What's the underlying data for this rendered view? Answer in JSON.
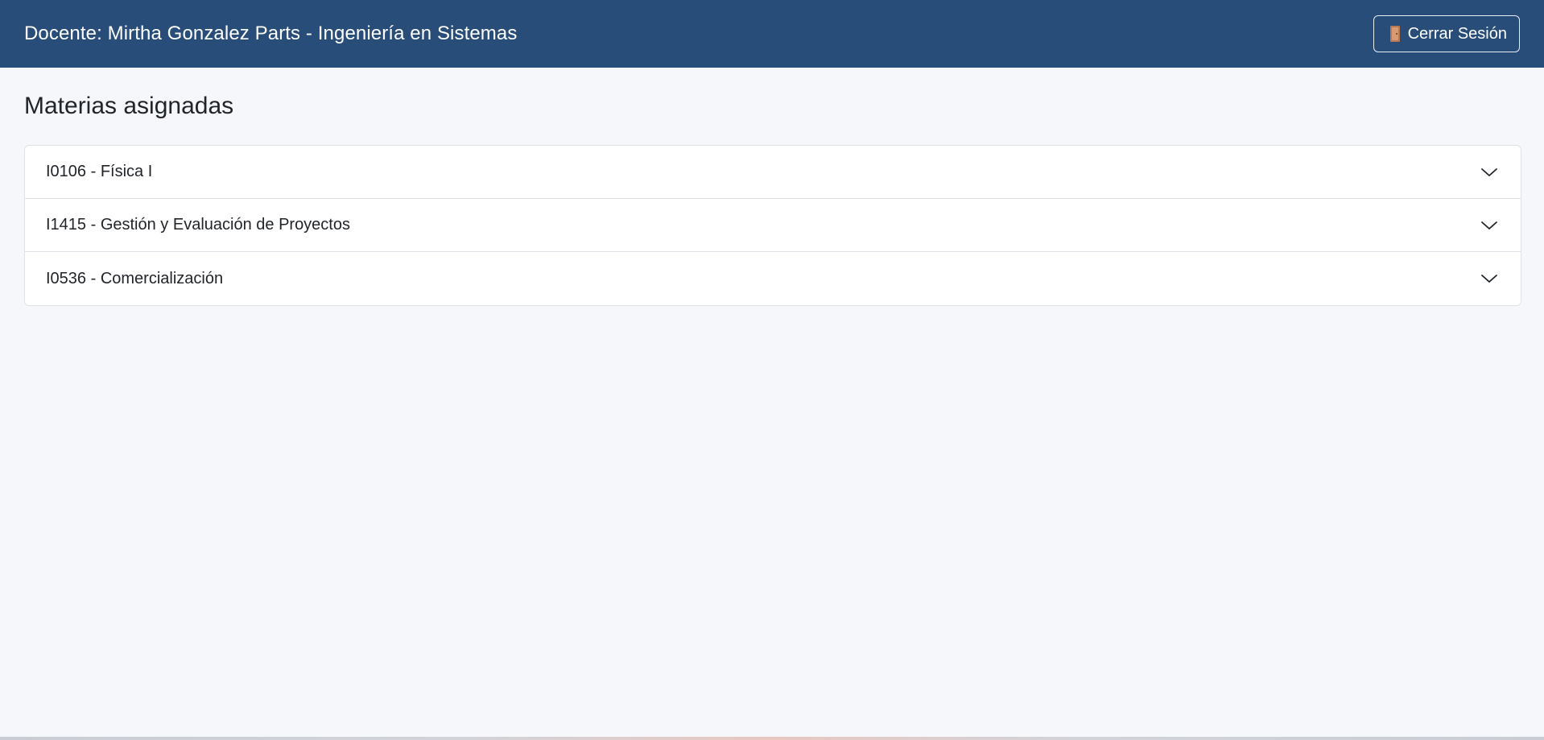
{
  "header": {
    "title": "Docente: Mirtha Gonzalez Parts - Ingeniería en Sistemas",
    "logout_label": "Cerrar Sesión",
    "logout_icon": "door-icon"
  },
  "main": {
    "title": "Materias asignadas",
    "subjects": [
      {
        "label": "I0106 - Física I",
        "icon": "chevron-down-icon"
      },
      {
        "label": "I1415 - Gestión y Evaluación de Proyectos",
        "icon": "chevron-down-icon"
      },
      {
        "label": "I0536 - Comercialización",
        "icon": "chevron-down-icon"
      }
    ]
  },
  "colors": {
    "header_bg": "#284d79",
    "page_bg": "#f5f7fb",
    "card_bg": "#ffffff",
    "border": "#dfe3e8"
  }
}
